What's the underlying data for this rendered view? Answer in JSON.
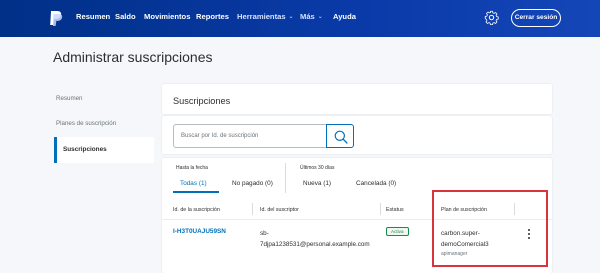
{
  "nav": {
    "items": [
      {
        "label": "Resumen"
      },
      {
        "label": "Saldo"
      },
      {
        "label": "Movimientos"
      },
      {
        "label": "Reportes"
      },
      {
        "label": "Herramientas"
      },
      {
        "label": "Más"
      },
      {
        "label": "Ayuda"
      }
    ],
    "logout_label": "Cerrar sesión"
  },
  "page": {
    "title": "Administrar suscripciones"
  },
  "sidebar": {
    "items": [
      {
        "label": "Resumen"
      },
      {
        "label": "Planes de suscripción"
      },
      {
        "label": "Suscripciones",
        "active": true
      }
    ]
  },
  "subscriptions": {
    "title": "Suscripciones",
    "search": {
      "placeholder": "Buscar por Id. de suscripción"
    }
  },
  "filters": {
    "group_to_date": "Hasta la fecha",
    "group_last_30": "Últimos 30 días",
    "tabs": [
      {
        "label": "Todas (1)",
        "active": true
      },
      {
        "label": "No pagado (0)"
      },
      {
        "label": "Nueva (1)"
      },
      {
        "label": "Cancelada (0)"
      }
    ]
  },
  "table": {
    "columns": [
      "Id. de la suscripción",
      "Id. del suscriptor",
      "Estatus",
      "Plan de suscripción"
    ],
    "rows": [
      {
        "id": "I-H3T0UAJU59SN",
        "subscriber_line1": "sb-",
        "subscriber_line2": "7djpa1238531@personal.example.com",
        "status": "Activa",
        "plan_line1": "carbon.super-",
        "plan_line2": "demoComercial3",
        "plan_sub": "apimanager"
      }
    ]
  },
  "colors": {
    "nav_bg": "#003087",
    "accent": "#0070ba",
    "status_active": "#1b8a4e",
    "highlight": "#d9343e"
  },
  "icons": {
    "logo": "paypal-logo-icon",
    "settings": "gear-icon",
    "search": "search-icon",
    "row_menu": "kebab-menu-icon"
  }
}
